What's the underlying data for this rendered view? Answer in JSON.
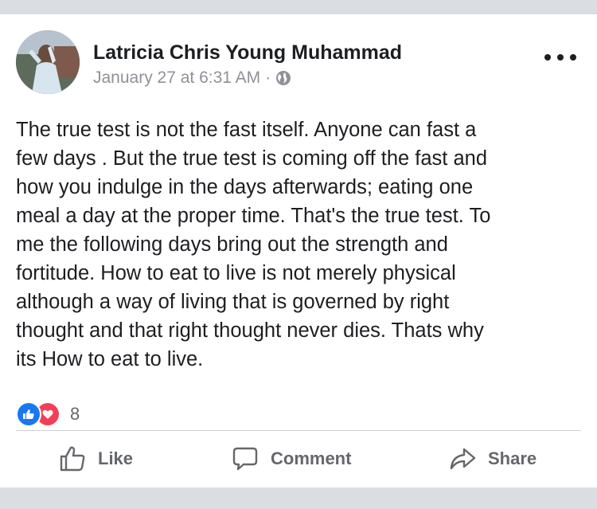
{
  "post": {
    "author": "Latricia Chris Young Muhammad",
    "timestamp": "January 27 at 6:31 AM",
    "separator": "·",
    "privacy_icon": "globe-icon",
    "lines": [
      "The true test is not the fast itself. Anyone can fast a",
      "few days . But the true test is coming off the fast and",
      "how you indulge in the days afterwards; eating one",
      "meal a day at the proper time. That's the true test. To",
      "me the following days bring out the strength and",
      "fortitude. How to eat to live is not merely physical",
      "although a way of living that is governed by right",
      "thought and that right thought never dies. Thats why",
      "its How to eat to live."
    ]
  },
  "reactions": {
    "count": "8",
    "types": [
      "like-icon",
      "love-icon"
    ]
  },
  "actions": {
    "like_label": "Like",
    "comment_label": "Comment",
    "share_label": "Share"
  },
  "colors": {
    "text": "#1c1e21",
    "muted": "#65676b",
    "like_blue": "#1877f2",
    "love_red": "#f33e58",
    "band": "#dadde1"
  }
}
